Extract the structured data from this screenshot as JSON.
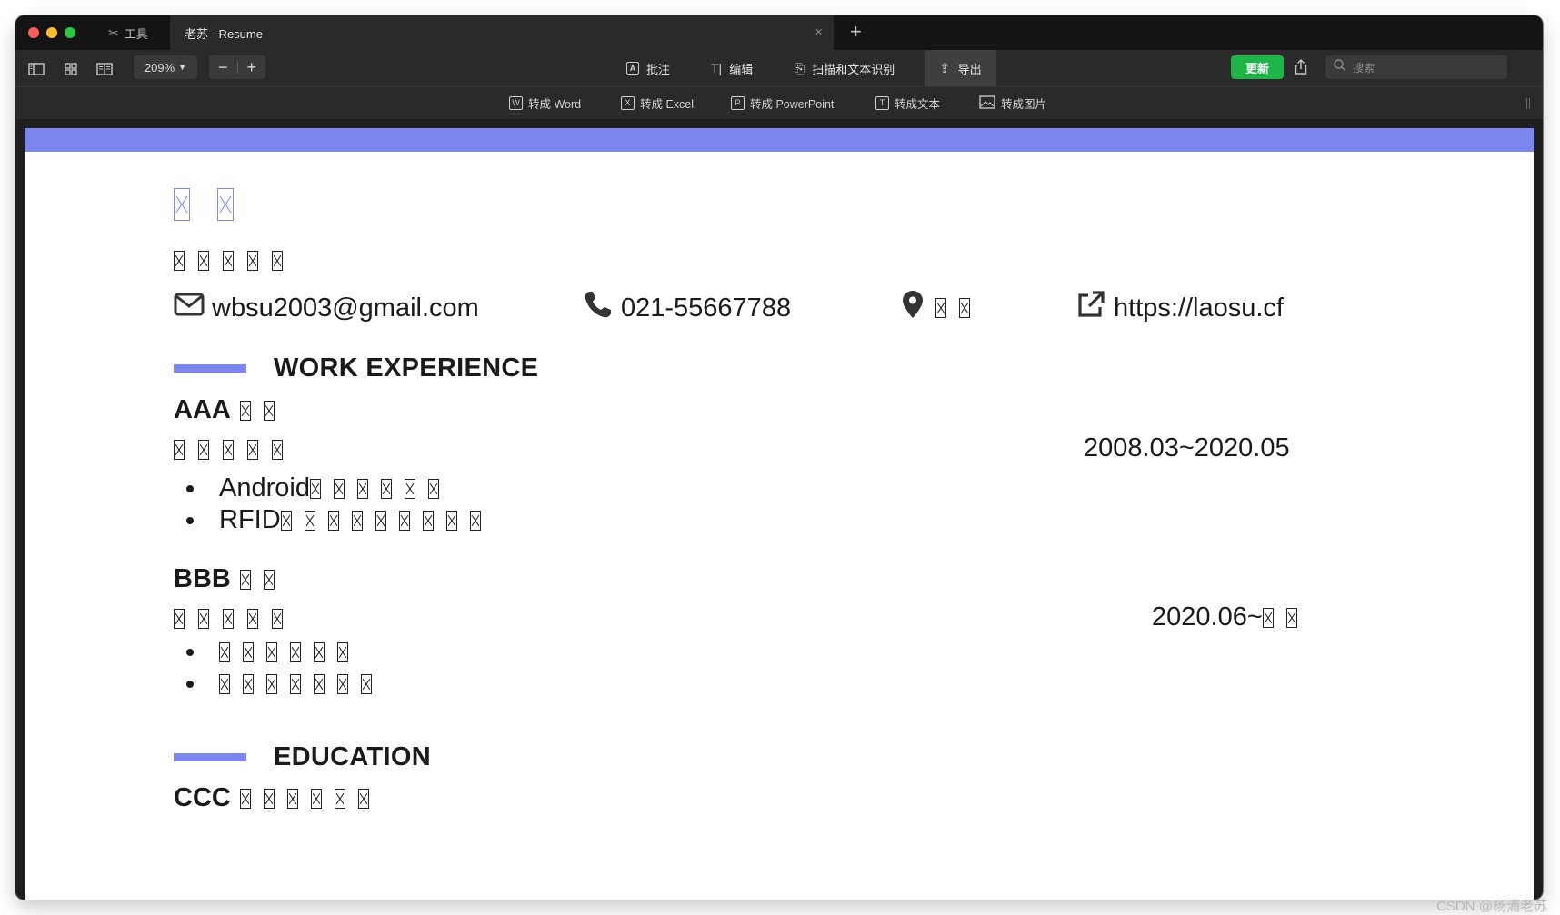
{
  "tabs": {
    "tools_label": "工具",
    "document_label": "老苏 - Resume"
  },
  "toolbar": {
    "zoom": "209%",
    "zoom_out": "−",
    "zoom_in": "+",
    "annotate": "批注",
    "edit": "编辑",
    "scan_ocr": "扫描和文本识别",
    "export": "导出",
    "update": "更新",
    "search_placeholder": "搜索"
  },
  "convert_bar": {
    "word": "转成 Word",
    "excel": "转成 Excel",
    "powerpoint": "转成 PowerPoint",
    "text": "转成文本",
    "image": "转成图片"
  },
  "resume": {
    "email": "wbsu2003@gmail.com",
    "phone": "021-55667788",
    "website": "https://laosu.cf",
    "work_title": "WORK EXPERIENCE",
    "jobs": [
      {
        "company": "AAA",
        "dates": "2008.03~2020.05",
        "bullets": [
          "Android",
          "RFID"
        ]
      },
      {
        "company": "BBB",
        "dates": "2020.06~"
      }
    ],
    "education_title": "EDUCATION",
    "school": "CCC"
  },
  "colors": {
    "accent": "#7b86ef",
    "update_green": "#1eb548"
  },
  "watermark": "CSDN @杨浦老苏"
}
